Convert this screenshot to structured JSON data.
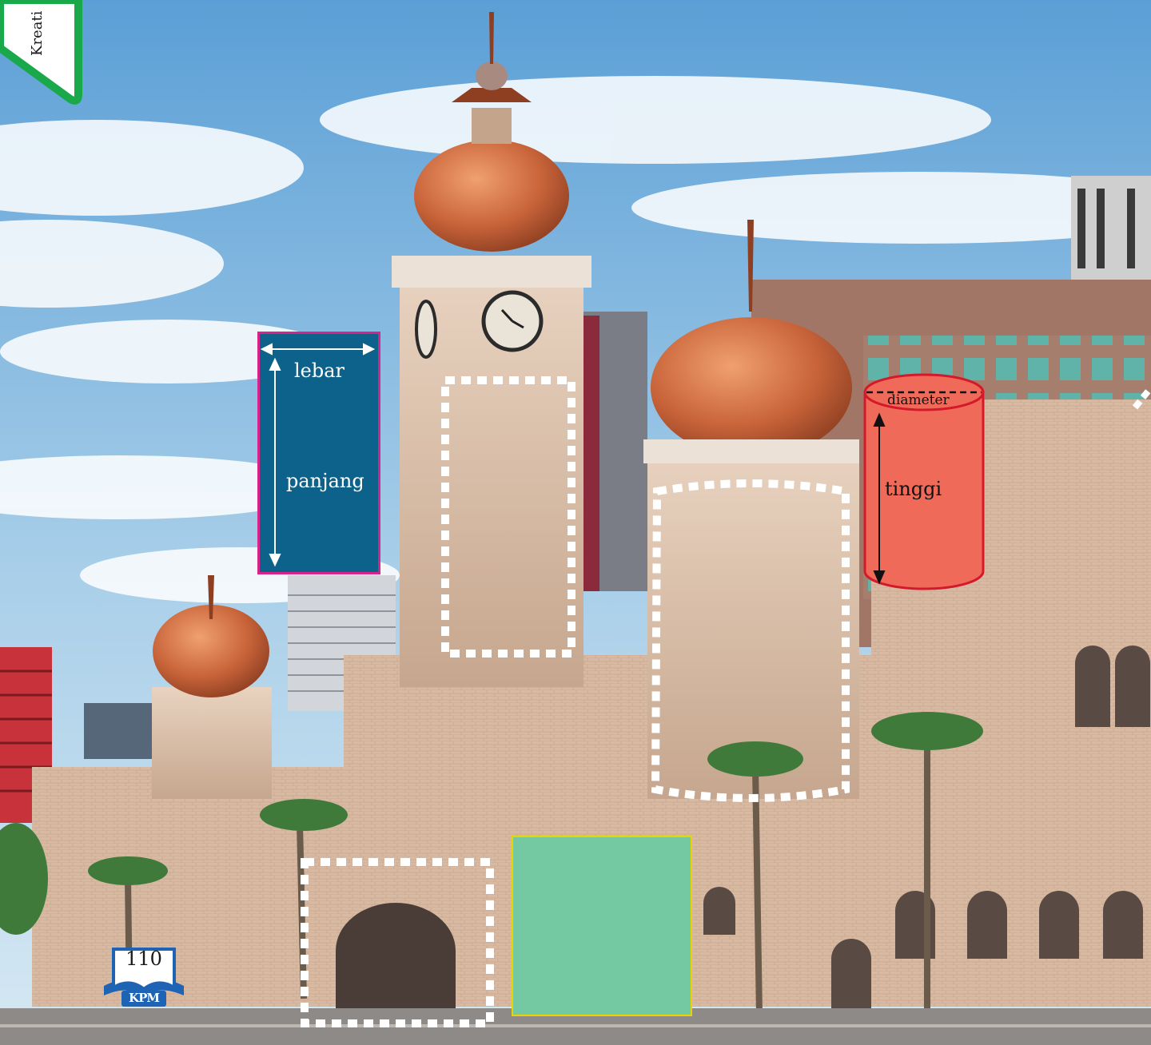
{
  "side_tab": {
    "text": "Kreati"
  },
  "rectangle_diagram": {
    "width_label": "lebar",
    "length_label": "panjang",
    "fill_color": "#0c628a",
    "border_color": "#d6248a"
  },
  "cylinder_diagram": {
    "diameter_label": "diameter",
    "height_label": "tinggi",
    "fill_color": "#f06a5a",
    "border_color": "#d41a2a"
  },
  "square_shape": {
    "fill_color": "#74c9a3",
    "border_color": "#e8d400"
  },
  "page": {
    "number": "110",
    "publisher": "KPM"
  }
}
